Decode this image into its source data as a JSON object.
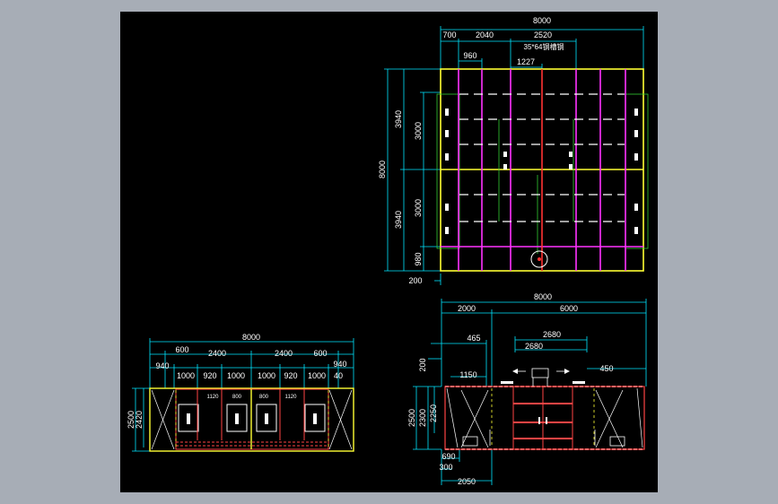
{
  "colors": {
    "background": "#a7adb6",
    "viewport": "#000000",
    "dimension": "#ffffff",
    "leader": "#00e5ff",
    "frame": "#ffff33",
    "beam": "#ff33ff",
    "grid": "#ff4444",
    "green": "#33cc33"
  },
  "plan": {
    "overall_width": "8000",
    "top_dims": [
      "700",
      "2040",
      "2520"
    ],
    "steel_label": "35*64钢槽钢",
    "sub_dims": [
      "960",
      "1227"
    ],
    "left_overall": "8000",
    "left_dims": [
      "3940",
      "3940"
    ],
    "left_inner": [
      "3000",
      "3000"
    ],
    "bottom_small": "980",
    "bottom_left": "200"
  },
  "front": {
    "overall_width": "8000",
    "row2": [
      "600",
      "2400",
      "2400",
      "600"
    ],
    "row3_left": "940",
    "row3_right": "940",
    "row3": [
      "1000",
      "920",
      "1000",
      "1000",
      "920",
      "1000",
      "40"
    ],
    "inner": [
      "1120",
      "800",
      "1120",
      "800"
    ],
    "height_outer": "2500",
    "height_inner": "2420"
  },
  "side": {
    "overall_width": "8000",
    "top_dims": [
      "2000",
      "6000"
    ],
    "mid_dims": [
      "465",
      "2680",
      "2680"
    ],
    "right_dim": "450",
    "left_dim": "1150",
    "top_small": "200",
    "heights": [
      "2500",
      "2300",
      "2250"
    ],
    "bottom_dims": [
      "690",
      "300",
      "2050"
    ]
  }
}
